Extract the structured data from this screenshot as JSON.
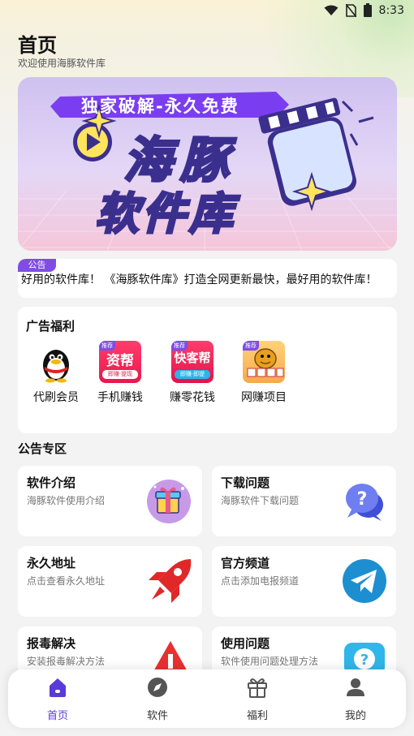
{
  "status": {
    "time": "8:33",
    "icons": [
      "wifi-icon",
      "no-sim-icon",
      "battery-icon"
    ]
  },
  "header": {
    "title": "首页",
    "subtitle": "欢迎使用海豚软件库"
  },
  "banner": {
    "top_ribbon": "独家破解-永久免费",
    "line1": "海豚",
    "line2": "软件库"
  },
  "notice": {
    "badge": "公告",
    "text": "好用的软件库！   《海豚软件库》打造全网更新最快，最好用的软件库！"
  },
  "ads": {
    "title": "广告福利",
    "items": [
      {
        "label": "代刷会员",
        "icon": "qq-penguin-icon",
        "tag": ""
      },
      {
        "label": "手机赚钱",
        "icon": "money-help-app-icon",
        "tag": "推荐",
        "icon_text": "资帮",
        "icon_sub": "即赚·提现"
      },
      {
        "label": "赚零花钱",
        "icon": "quick-guest-app-icon",
        "tag": "推荐",
        "icon_text": "快客帮",
        "icon_sub": "即赚·即提"
      },
      {
        "label": "网赚项目",
        "icon": "money-project-app-icon",
        "tag": "推荐"
      }
    ]
  },
  "section": {
    "title": "公告专区"
  },
  "cards": [
    {
      "title": "软件介绍",
      "desc": "海豚软件使用介绍",
      "icon": "gift-box-icon"
    },
    {
      "title": "下载问题",
      "desc": "海豚软件下载问题",
      "icon": "question-chat-icon"
    },
    {
      "title": "永久地址",
      "desc": "点击查看永久地址",
      "icon": "rocket-icon"
    },
    {
      "title": "官方频道",
      "desc": "点击添加电报频道",
      "icon": "telegram-icon"
    },
    {
      "title": "报毒解决",
      "desc": "安装报毒解决方法",
      "icon": "warning-icon"
    },
    {
      "title": "使用问题",
      "desc": "软件使用问题处理方法",
      "icon": "help-chat-icon"
    }
  ],
  "nav": {
    "items": [
      {
        "label": "首页",
        "icon": "home-icon",
        "active": true
      },
      {
        "label": "软件",
        "icon": "compass-icon",
        "active": false
      },
      {
        "label": "福利",
        "icon": "gift-icon",
        "active": false
      },
      {
        "label": "我的",
        "icon": "user-icon",
        "active": false
      }
    ]
  },
  "colors": {
    "accent": "#7f4de6",
    "nav_active": "#5a3ad8",
    "banner_text": "#ffe45c"
  }
}
